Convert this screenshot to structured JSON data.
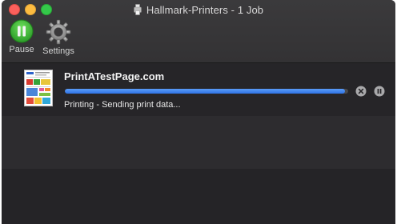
{
  "window": {
    "title": "Hallmark-Printers - 1 Job"
  },
  "toolbar": {
    "pause_label": "Pause",
    "settings_label": "Settings"
  },
  "jobs": [
    {
      "name": "PrintATestPage.com",
      "status": "Printing - Sending print data...",
      "progress_fraction": 0.99
    }
  ],
  "colors": {
    "close": "#fc605c",
    "minimize": "#fdbc40",
    "maximize": "#34c84a",
    "pause_green": "#32b52f",
    "progress_blue": "#3a80ec"
  },
  "icons": {
    "printer": "printer-icon",
    "pause": "pause-icon",
    "settings": "gear-icon",
    "cancel": "close-icon",
    "hold": "pause-circle-icon"
  }
}
